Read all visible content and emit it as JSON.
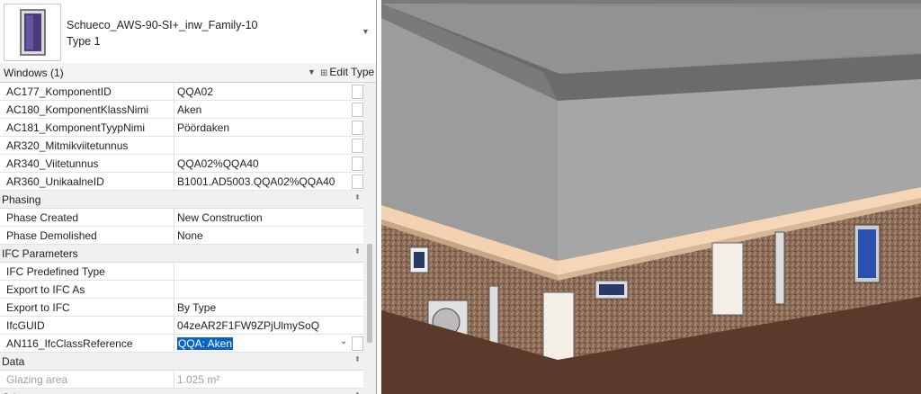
{
  "type_selector": {
    "family": "Schueco_AWS-90-SI+_inw_Family-10",
    "type": "Type 1"
  },
  "filter": {
    "label": "Windows (1)",
    "edit_type": "Edit Type"
  },
  "rows_top": [
    {
      "name": "AC177_KomponentID",
      "value": "QQA02"
    },
    {
      "name": "AC180_KomponentKlassNimi",
      "value": "Aken"
    },
    {
      "name": "AC181_KomponentTyypNimi",
      "value": "Pöördaken"
    },
    {
      "name": "AR320_Mitmikviitetunnus",
      "value": ""
    },
    {
      "name": "AR340_Viitetunnus",
      "value": "QQA02%QQA40"
    },
    {
      "name": "AR360_UnikaalneID",
      "value": "B1001.AD5003.QQA02%QQA40"
    }
  ],
  "sections": {
    "phasing": "Phasing",
    "ifc": "IFC Parameters",
    "data": "Data",
    "other": "Other"
  },
  "phasing_rows": [
    {
      "name": "Phase Created",
      "value": "New Construction"
    },
    {
      "name": "Phase Demolished",
      "value": "None"
    }
  ],
  "ifc_rows": [
    {
      "name": "IFC Predefined Type",
      "value": ""
    },
    {
      "name": "Export to IFC As",
      "value": ""
    },
    {
      "name": "Export to IFC",
      "value": "By Type"
    },
    {
      "name": "IfcGUID",
      "value": "04zeAR2F1FW9ZPjUlmySoQ"
    },
    {
      "name": "AN116_IfcClassReference",
      "value": "QQA: Aken"
    }
  ],
  "data_rows": [
    {
      "name": "Glazing area",
      "value": "1.025 m²"
    }
  ],
  "icons": [
    "window-thumbnail-icon",
    "dropdown-arrow-icon",
    "edit-type-icon",
    "collapse-icon",
    "checkbox-icon"
  ],
  "colors": {
    "selection": "#0a64c8",
    "roof": "#8f8f8f",
    "brick": "#8a6a55",
    "fascia": "#f2d2b0"
  }
}
